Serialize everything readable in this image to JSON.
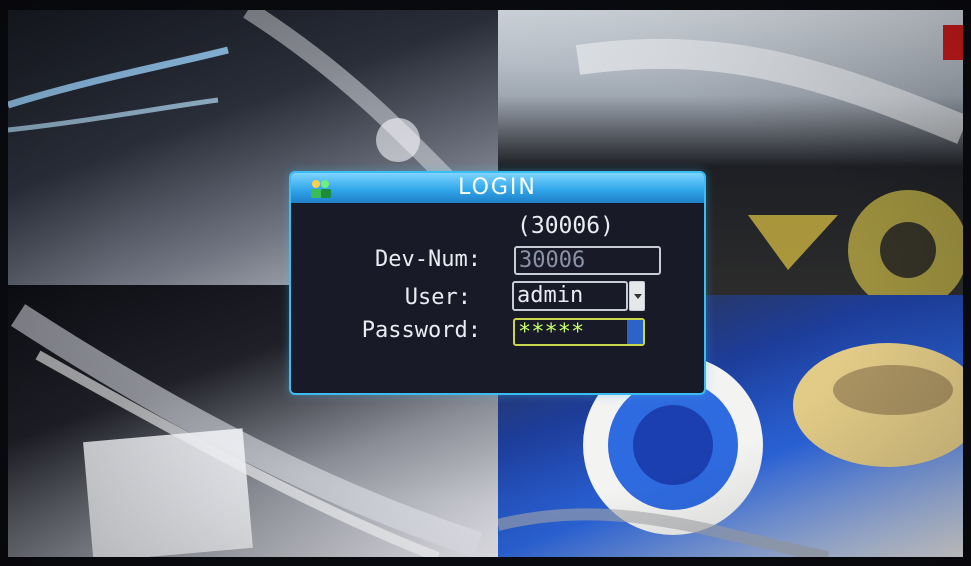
{
  "dialog": {
    "title": "LOGIN",
    "device_id_display": "(30006)",
    "fields": {
      "dev_num_label": "Dev-Num:",
      "dev_num_value": "30006",
      "user_label": "User:",
      "user_value": "admin",
      "password_label": "Password:",
      "password_value": "*****"
    }
  },
  "colors": {
    "dialog_border": "#3bbcf2",
    "title_bar": "#31a7eb",
    "text": "#e9edf2",
    "password_text": "#c8ff6a"
  }
}
